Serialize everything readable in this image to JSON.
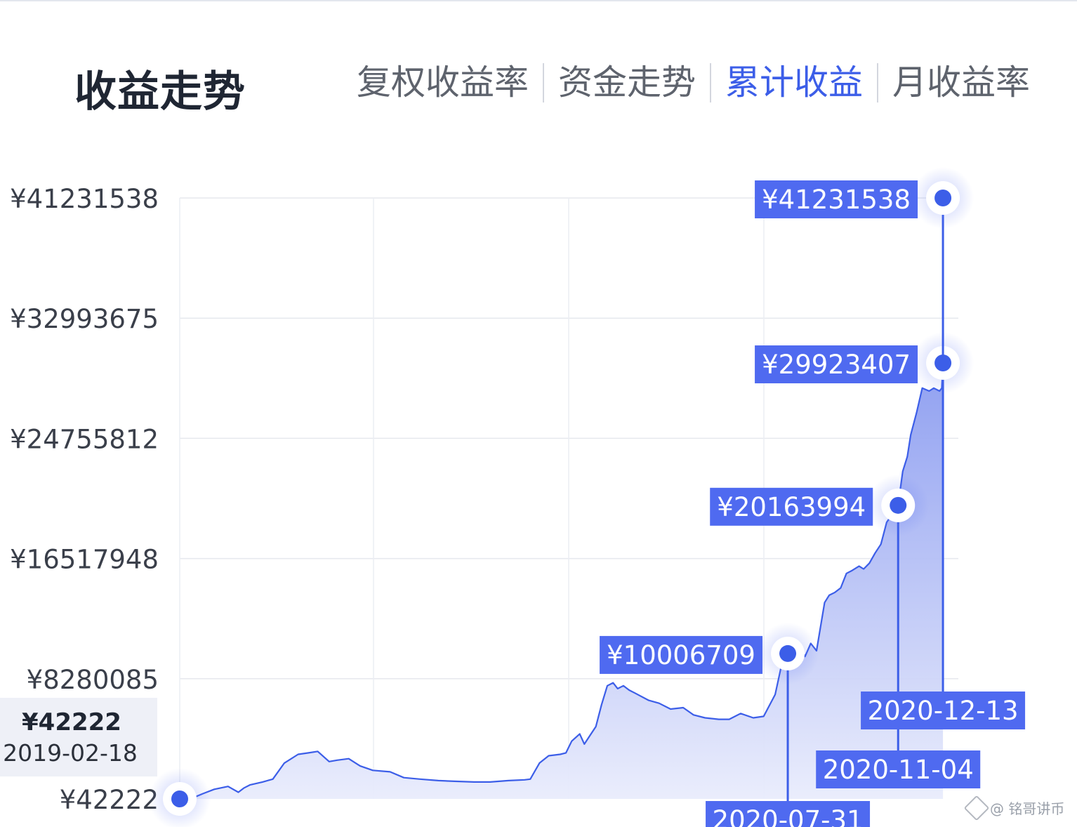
{
  "header": {
    "title": "收益走势",
    "tabs": [
      {
        "label": "复权收益率",
        "active": false
      },
      {
        "label": "资金走势",
        "active": false
      },
      {
        "label": "累计收益",
        "active": true
      },
      {
        "label": "月收益率",
        "active": false
      }
    ]
  },
  "colors": {
    "accent": "#3c5ee8",
    "label_bg": "#4f6af0",
    "area_top": "#8a9bf0",
    "area_bottom": "#e9ecfc",
    "title": "#1f2633"
  },
  "chart_data": {
    "type": "area",
    "y_ticks": [
      "¥41231538",
      "¥32993675",
      "¥24755812",
      "¥16517948",
      "¥8280085",
      "¥42222"
    ],
    "y_tick_values": [
      41231538,
      32993675,
      24755812,
      16517948,
      8280085,
      42222
    ],
    "ylim": [
      42222,
      41231538
    ],
    "xlim": [
      "2019-02-18",
      "2020-12-27"
    ],
    "grid": true,
    "tooltip": {
      "value": "¥42222",
      "date": "2019-02-18"
    },
    "series": [
      {
        "x": [
          "2019-02-18",
          "2019-03-01",
          "2019-03-10",
          "2019-03-20",
          "2019-04-01",
          "2019-04-10",
          "2019-04-15",
          "2019-04-20",
          "2019-05-01",
          "2019-05-10",
          "2019-05-20",
          "2019-06-01",
          "2019-06-10",
          "2019-06-18",
          "2019-06-28",
          "2019-07-05",
          "2019-07-15",
          "2019-07-25",
          "2019-08-05",
          "2019-08-20",
          "2019-09-01",
          "2019-09-15",
          "2019-10-01",
          "2019-10-15",
          "2019-11-01",
          "2019-11-15",
          "2019-12-01",
          "2019-12-15",
          "2019-12-20",
          "2019-12-28",
          "2020-01-05",
          "2020-01-15",
          "2020-01-20",
          "2020-01-25",
          "2020-02-01",
          "2020-02-05",
          "2020-02-10",
          "2020-02-15",
          "2020-02-20",
          "2020-02-25",
          "2020-03-01",
          "2020-03-05",
          "2020-03-10",
          "2020-03-15",
          "2020-03-20",
          "2020-04-01",
          "2020-04-10",
          "2020-04-20",
          "2020-05-01",
          "2020-05-10",
          "2020-05-20",
          "2020-06-01",
          "2020-06-10",
          "2020-06-20",
          "2020-07-01",
          "2020-07-10",
          "2020-07-20",
          "2020-07-25",
          "2020-07-31",
          "2020-08-05",
          "2020-08-10",
          "2020-08-15",
          "2020-08-20",
          "2020-08-25",
          "2020-09-01",
          "2020-09-05",
          "2020-09-10",
          "2020-09-15",
          "2020-09-20",
          "2020-09-25",
          "2020-10-01",
          "2020-10-05",
          "2020-10-10",
          "2020-10-15",
          "2020-10-20",
          "2020-10-25",
          "2020-11-01",
          "2020-11-04",
          "2020-11-08",
          "2020-11-12",
          "2020-11-15",
          "2020-11-20",
          "2020-11-25",
          "2020-12-01",
          "2020-12-05",
          "2020-12-10",
          "2020-12-12",
          "2020-12-13"
        ],
        "y": [
          42222,
          100000,
          400000,
          700000,
          900000,
          500000,
          800000,
          1000000,
          1200000,
          1400000,
          2500000,
          3100000,
          3200000,
          3300000,
          2600000,
          2700000,
          2800000,
          2300000,
          2000000,
          1900000,
          1500000,
          1400000,
          1300000,
          1250000,
          1200000,
          1200000,
          1300000,
          1350000,
          1400000,
          2500000,
          3000000,
          3100000,
          3200000,
          4000000,
          4500000,
          3800000,
          4400000,
          5000000,
          6500000,
          7800000,
          8000000,
          7600000,
          7800000,
          7500000,
          7300000,
          6800000,
          6600000,
          6200000,
          6300000,
          5800000,
          5600000,
          5500000,
          5500000,
          5900000,
          5600000,
          5700000,
          7200000,
          9000000,
          10006709,
          10500000,
          10600000,
          9800000,
          10700000,
          10200000,
          13500000,
          14000000,
          14200000,
          14500000,
          15500000,
          15700000,
          16000000,
          15800000,
          16200000,
          16900000,
          17500000,
          19000000,
          19800000,
          20163994,
          22500000,
          23500000,
          25000000,
          26500000,
          28200000,
          28000000,
          28200000,
          28000000,
          28200000,
          29923407
        ]
      }
    ],
    "markers": [
      {
        "date": "2019-02-18",
        "value": 42222,
        "show_value_label": false,
        "show_date_label": false
      },
      {
        "date": "2020-07-31",
        "value": 10006709,
        "value_label": "¥10006709",
        "date_label": "2020-07-31"
      },
      {
        "date": "2020-11-04",
        "value": 20163994,
        "value_label": "¥20163994",
        "date_label": "2020-11-04"
      },
      {
        "date": "2020-12-13",
        "value": 29923407,
        "value_label": "¥29923407",
        "date_label": "2020-12-13"
      },
      {
        "date": "2020-12-13",
        "value": 41231538,
        "value_label": "¥41231538",
        "show_date_label": false
      }
    ]
  },
  "watermark": {
    "text": "@ 铭哥讲币"
  }
}
